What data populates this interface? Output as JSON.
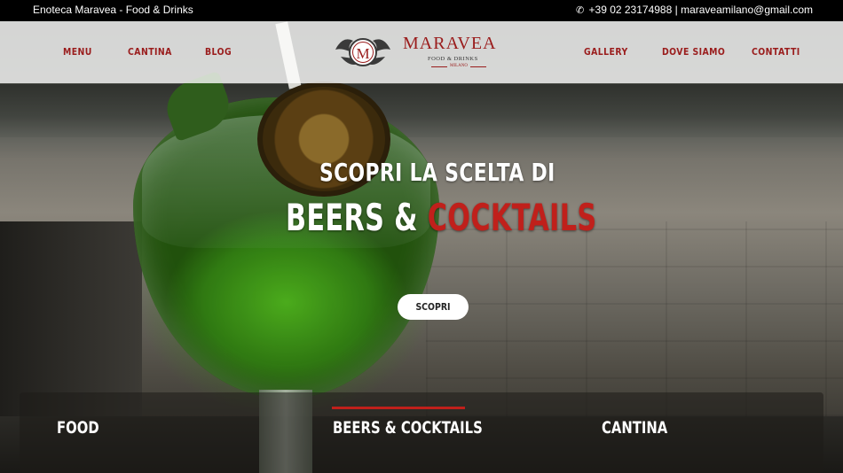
{
  "topbar": {
    "brand": "Enoteca Maravea - Food & Drinks",
    "phone": "+39 02 23174988",
    "separator": "|",
    "email": "maraveamilano@gmail.com"
  },
  "nav": {
    "left": [
      "MENU",
      "CANTINA",
      "BLOG"
    ],
    "right": [
      "GALLERY",
      "DOVE SIAMO",
      "CONTATTI"
    ]
  },
  "logo": {
    "letter": "M",
    "name": "MARAVEA",
    "sub": "FOOD & DRINKS",
    "city": "MILANO"
  },
  "hero": {
    "subtitle": "SCOPRI LA SCELTA DI",
    "title_white": "BEERS & ",
    "title_red": "COCKTAILS",
    "cta": "SCOPRI"
  },
  "categories": [
    "FOOD",
    "BEERS & COCKTAILS",
    "CANTINA"
  ],
  "colors": {
    "accent": "#9a1c1c",
    "highlight": "#c0201b",
    "topbar": "#000000"
  }
}
